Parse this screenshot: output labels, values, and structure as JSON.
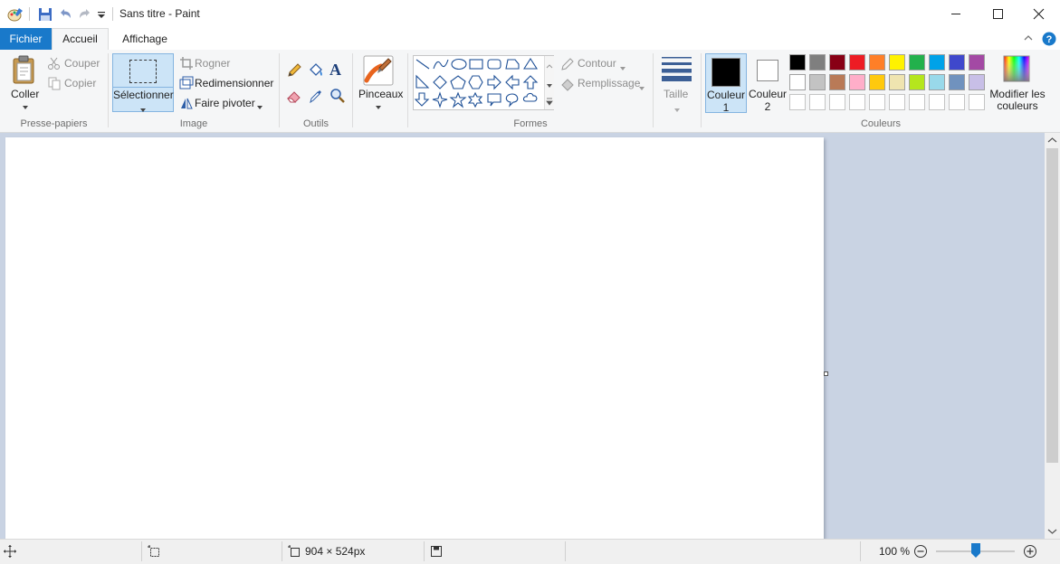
{
  "window": {
    "title": "Sans titre - Paint"
  },
  "tabs": {
    "file": "Fichier",
    "home": "Accueil",
    "view": "Affichage"
  },
  "clipboard": {
    "paste": "Coller",
    "cut": "Couper",
    "copy": "Copier",
    "group": "Presse-papiers"
  },
  "image": {
    "select": "Sélectionner",
    "crop": "Rogner",
    "resize": "Redimensionner",
    "rotate": "Faire pivoter",
    "group": "Image"
  },
  "tools": {
    "group": "Outils",
    "text_glyph": "A"
  },
  "brushes": {
    "label": "Pinceaux"
  },
  "shapes": {
    "outline": "Contour",
    "fill": "Remplissage",
    "group": "Formes"
  },
  "size": {
    "label": "Taille"
  },
  "colors": {
    "color1_label": "Couleur",
    "color1_num": "1",
    "color2_label": "Couleur",
    "color2_num": "2",
    "edit_line1": "Modifier les",
    "edit_line2": "couleurs",
    "group": "Couleurs",
    "color1_value": "#000000",
    "color2_value": "#ffffff",
    "palette_row1": [
      "#000000",
      "#7f7f7f",
      "#880015",
      "#ed1c24",
      "#ff7f27",
      "#fff200",
      "#22b14c",
      "#00a2e8",
      "#3f48cc",
      "#a349a4"
    ],
    "palette_row2": [
      "#ffffff",
      "#c3c3c3",
      "#b97a57",
      "#ffaec9",
      "#ffc90e",
      "#efe4b0",
      "#b5e61d",
      "#99d9ea",
      "#7092be",
      "#c8bfe7"
    ]
  },
  "status": {
    "dimensions": "904 × 524px",
    "zoom": "100 %",
    "zoom_level": 0.5
  }
}
